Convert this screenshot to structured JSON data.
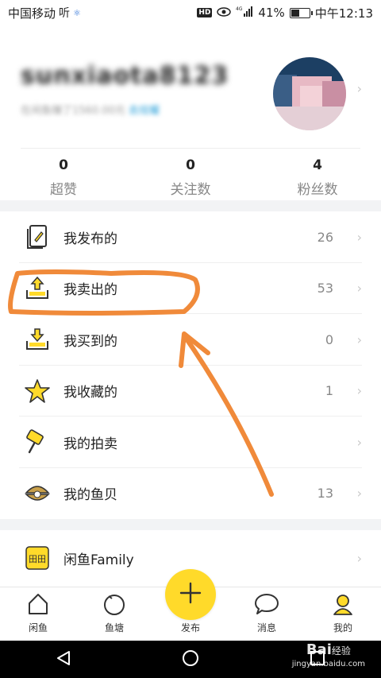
{
  "status": {
    "carrier": "中国移动",
    "hd": "HD",
    "battery_pct": "41%",
    "battery_level": 0.41,
    "time": "中午12:13"
  },
  "profile": {
    "username": "sunxiaota8123",
    "subline_prefix": "在闲鱼赚了1560.00元",
    "subline_link": "去炫耀"
  },
  "stats": [
    {
      "num": "0",
      "label": "超赞"
    },
    {
      "num": "0",
      "label": "关注数"
    },
    {
      "num": "4",
      "label": "粉丝数"
    }
  ],
  "menu": [
    {
      "label": "我发布的",
      "count": "26",
      "icon": "document-icon"
    },
    {
      "label": "我卖出的",
      "count": "53",
      "icon": "outbox-icon"
    },
    {
      "label": "我买到的",
      "count": "0",
      "icon": "inbox-icon"
    },
    {
      "label": "我收藏的",
      "count": "1",
      "icon": "star-icon"
    },
    {
      "label": "我的拍卖",
      "count": "",
      "icon": "gavel-icon"
    },
    {
      "label": "我的鱼贝",
      "count": "13",
      "icon": "shell-icon"
    }
  ],
  "family": {
    "label": "闲鱼Family",
    "icon": "family-icon"
  },
  "tabs": [
    {
      "label": "闲鱼",
      "icon": "home-icon"
    },
    {
      "label": "鱼塘",
      "icon": "pond-icon"
    },
    {
      "label": "发布",
      "icon": "plus-icon"
    },
    {
      "label": "消息",
      "icon": "message-icon"
    },
    {
      "label": "我的",
      "icon": "profile-icon"
    }
  ],
  "watermark": {
    "brand": "Bai",
    "brand2": "经验",
    "url": "jingyan.baidu.com"
  },
  "colors": {
    "accent": "#ffda2a",
    "annotation": "#f08a3a",
    "link": "#1e9bd7"
  }
}
